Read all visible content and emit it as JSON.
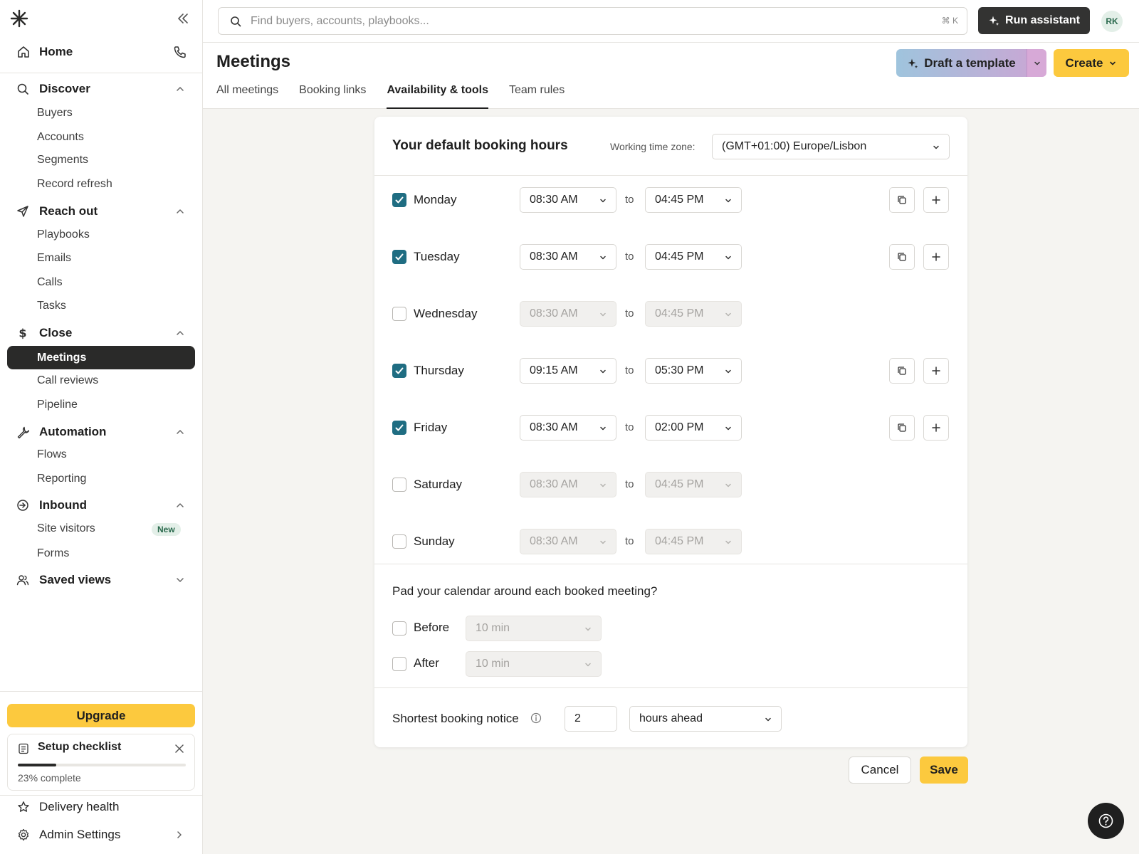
{
  "sidebar": {
    "home_label": "Home",
    "sections": {
      "discover": {
        "label": "Discover",
        "items": [
          "Buyers",
          "Accounts",
          "Segments",
          "Record refresh"
        ]
      },
      "reach_out": {
        "label": "Reach out",
        "items": [
          "Playbooks",
          "Emails",
          "Calls",
          "Tasks"
        ]
      },
      "close": {
        "label": "Close",
        "items": [
          "Meetings",
          "Call reviews",
          "Pipeline"
        ]
      },
      "automation": {
        "label": "Automation",
        "items": [
          "Flows",
          "Reporting"
        ]
      },
      "inbound": {
        "label": "Inbound",
        "items": [
          "Site visitors",
          "Forms"
        ],
        "badge": "New"
      },
      "saved_views": {
        "label": "Saved views"
      }
    },
    "upgrade_label": "Upgrade",
    "checklist": {
      "title": "Setup checklist",
      "progress_text": "23% complete",
      "progress": 0.23
    },
    "delivery_health": "Delivery health",
    "admin_settings": "Admin Settings"
  },
  "topbar": {
    "search_placeholder": "Find buyers, accounts, playbooks...",
    "shortcut": "⌘ K",
    "run_assistant": "Run assistant",
    "avatar_initials": "RK"
  },
  "page": {
    "title": "Meetings",
    "tabs": [
      "All meetings",
      "Booking links",
      "Availability & tools",
      "Team rules"
    ],
    "active_tab": "Availability & tools",
    "draft_template": "Draft a template",
    "create": "Create"
  },
  "booking": {
    "title": "Your default booking hours",
    "timezone_label": "Working time zone:",
    "timezone": "(GMT+01:00) Europe/Lisbon",
    "to_label": "to",
    "days": [
      {
        "name": "Monday",
        "enabled": true,
        "start": "08:30 AM",
        "end": "04:45 PM"
      },
      {
        "name": "Tuesday",
        "enabled": true,
        "start": "08:30 AM",
        "end": "04:45 PM"
      },
      {
        "name": "Wednesday",
        "enabled": false,
        "start": "08:30 AM",
        "end": "04:45 PM"
      },
      {
        "name": "Thursday",
        "enabled": true,
        "start": "09:15 AM",
        "end": "05:30 PM"
      },
      {
        "name": "Friday",
        "enabled": true,
        "start": "08:30 AM",
        "end": "02:00 PM"
      },
      {
        "name": "Saturday",
        "enabled": false,
        "start": "08:30 AM",
        "end": "04:45 PM"
      },
      {
        "name": "Sunday",
        "enabled": false,
        "start": "08:30 AM",
        "end": "04:45 PM"
      }
    ],
    "padding": {
      "question": "Pad your calendar around each booked meeting?",
      "before_label": "Before",
      "before_value": "10 min",
      "after_label": "After",
      "after_value": "10 min"
    },
    "notice": {
      "label": "Shortest booking notice",
      "value": "2",
      "unit": "hours ahead"
    }
  },
  "actions": {
    "cancel": "Cancel",
    "save": "Save"
  },
  "colors": {
    "accent_yellow": "#fcc93e",
    "checkbox_teal": "#1f6d82",
    "dark": "#2a2a29"
  }
}
